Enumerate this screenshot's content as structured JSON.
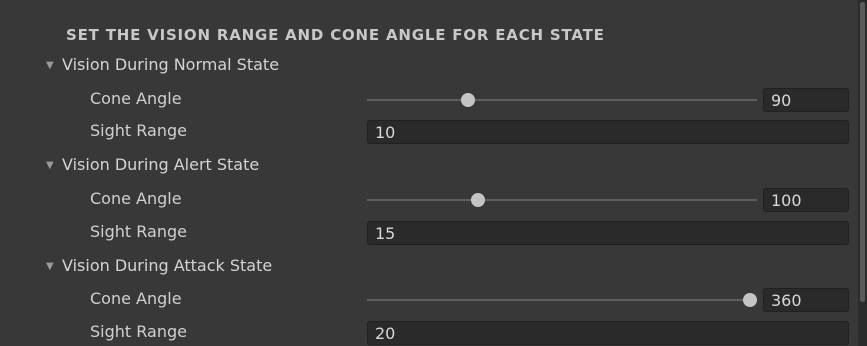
{
  "header": "SET THE VISION RANGE AND CONE ANGLE FOR EACH STATE",
  "sections": [
    {
      "title": "Vision During Normal State",
      "cone_label": "Cone Angle",
      "cone_value": "90",
      "range_label": "Sight Range",
      "range_value": "10"
    },
    {
      "title": "Vision During Alert State",
      "cone_label": "Cone Angle",
      "cone_value": "100",
      "range_label": "Sight Range",
      "range_value": "15"
    },
    {
      "title": "Vision During Attack State",
      "cone_label": "Cone Angle",
      "cone_value": "360",
      "range_label": "Sight Range",
      "range_value": "20"
    }
  ],
  "slider": {
    "min": 0,
    "max": 360
  },
  "icons": {
    "foldout": "triangle-down-icon"
  }
}
